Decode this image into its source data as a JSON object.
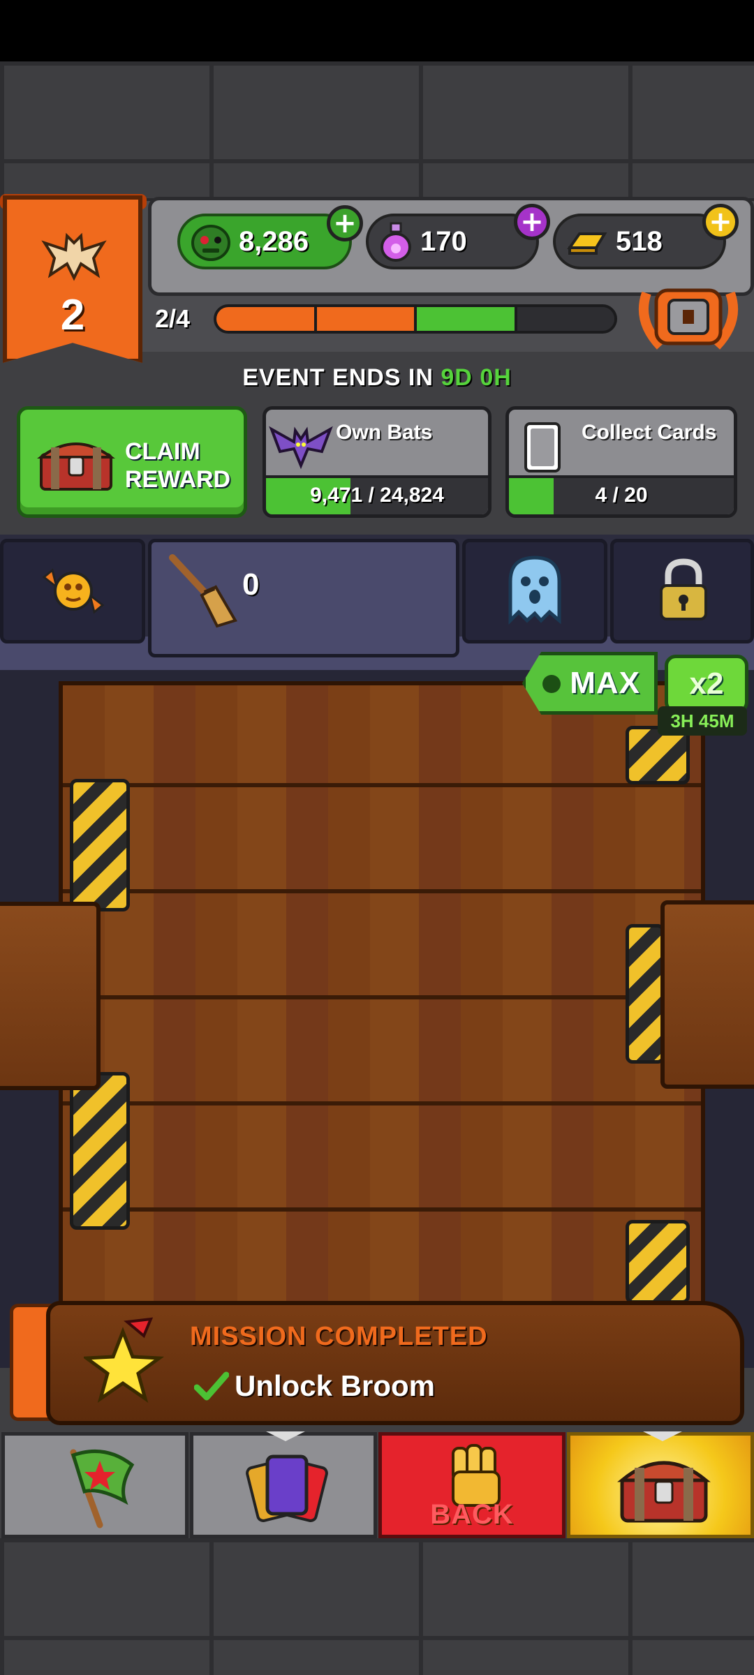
{
  "header": {
    "level": "2",
    "progress_label": "2/4",
    "currencies": [
      {
        "name": "zombie-coins",
        "value": "8,286",
        "color": "#3aa52c"
      },
      {
        "name": "potion",
        "value": "170",
        "color": "#a533c9"
      },
      {
        "name": "gold",
        "value": "518",
        "color": "#f1c21a"
      }
    ],
    "progress_segments": [
      {
        "state": "done",
        "color": "#f06a1d"
      },
      {
        "state": "done",
        "color": "#f06a1d"
      },
      {
        "state": "current",
        "color": "#4cc234"
      },
      {
        "state": "empty",
        "color": "#2d2d31"
      }
    ]
  },
  "event": {
    "prefix": "EVENT ENDS IN ",
    "days": "9D",
    "hours": "0H"
  },
  "tasks": {
    "claim_line1": "CLAIM",
    "claim_line2": "REWARD",
    "own_bats": {
      "title": "Own Bats",
      "progress_text": "9,471 / 24,824",
      "fraction": 0.381
    },
    "collect_cards": {
      "title": "Collect Cards",
      "progress_text": "4 / 20",
      "fraction": 0.2
    }
  },
  "tools": {
    "broom_count": "0"
  },
  "boost": {
    "max_label": "MAX",
    "multiplier": "x2",
    "timer": "3H 45M"
  },
  "mission": {
    "title": "MISSION COMPLETED",
    "task": "Unlock Broom"
  },
  "nav": {
    "back_label": "BACK"
  },
  "colors": {
    "accent_orange": "#f06a1d",
    "green": "#4cc234",
    "back_red": "#e5232c"
  }
}
